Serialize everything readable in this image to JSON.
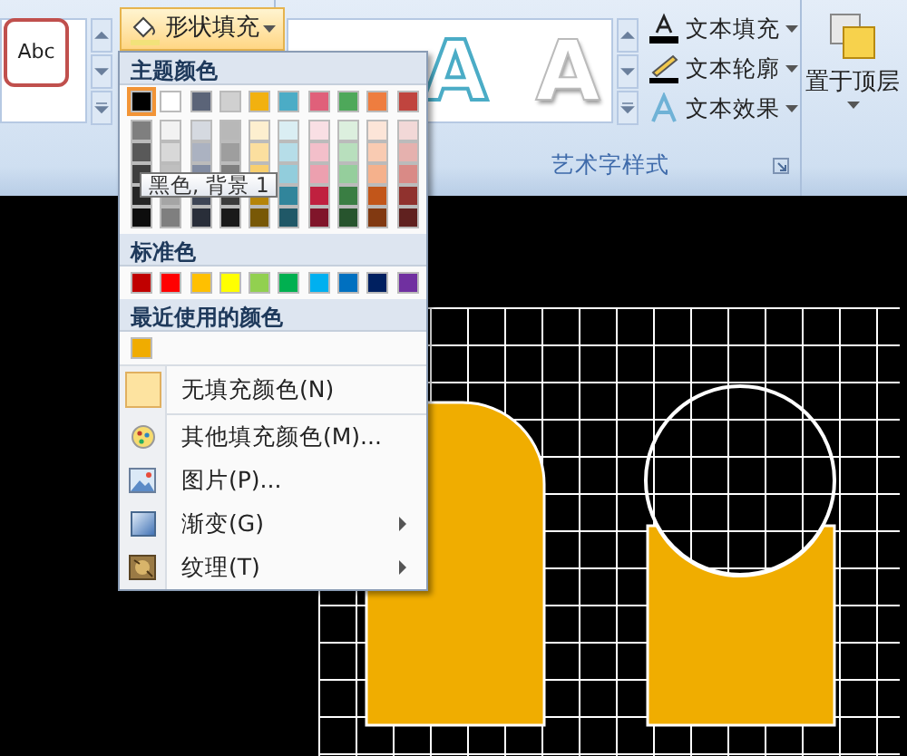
{
  "ribbon": {
    "style_sample": {
      "text": "Abc",
      "selected": true
    },
    "shape_fill_button": "形状填充",
    "wordart_samples": [
      {
        "text": "A",
        "kind": "outline"
      },
      {
        "text": "A",
        "kind": "emboss"
      }
    ],
    "text_buttons": [
      {
        "label": "文本填充",
        "kind": "fill"
      },
      {
        "label": "文本轮廓",
        "kind": "outline"
      },
      {
        "label": "文本效果",
        "kind": "effect"
      }
    ],
    "wordart_group_label": "艺术字样式",
    "arrange_button": "置于顶层"
  },
  "color_menu": {
    "theme_header": "主题颜色",
    "theme_colors": [
      {
        "color": "#000000",
        "selected": true,
        "shades": [
          {
            "color": "#7f7f7f"
          },
          {
            "color": "#595959"
          },
          {
            "color": "#3f3f3f"
          },
          {
            "color": "#262626"
          },
          {
            "color": "#0d0d0d"
          }
        ]
      },
      {
        "color": "#ffffff",
        "selected": false,
        "shades": [
          {
            "color": "#f2f2f2"
          },
          {
            "color": "#d8d8d8"
          },
          {
            "color": "#bfbfbf"
          },
          {
            "color": "#a5a5a5"
          },
          {
            "color": "#7f7f7f"
          }
        ]
      },
      {
        "color": "#5b6478",
        "selected": false,
        "shades": [
          {
            "color": "#d5d9e0"
          },
          {
            "color": "#abb2c1"
          },
          {
            "color": "#828ca2"
          },
          {
            "color": "#3e4555"
          },
          {
            "color": "#292e39"
          }
        ]
      },
      {
        "color": "#d0d0d0",
        "selected": false,
        "shades": [
          {
            "color": "#b8b8b8"
          },
          {
            "color": "#9e9e9e"
          },
          {
            "color": "#7f7f7f"
          },
          {
            "color": "#3b3b3b"
          },
          {
            "color": "#1a1a1a"
          }
        ]
      },
      {
        "color": "#f2b10f",
        "selected": false,
        "shades": [
          {
            "color": "#fdefcf"
          },
          {
            "color": "#fbdf9f"
          },
          {
            "color": "#f8cf6f"
          },
          {
            "color": "#b58409"
          },
          {
            "color": "#785806"
          }
        ]
      },
      {
        "color": "#4bacc6",
        "selected": false,
        "shades": [
          {
            "color": "#daeef3"
          },
          {
            "color": "#b6dde8"
          },
          {
            "color": "#92cddc"
          },
          {
            "color": "#31859b"
          },
          {
            "color": "#205867"
          }
        ]
      },
      {
        "color": "#e0607a",
        "selected": false,
        "shades": [
          {
            "color": "#f9dfe4"
          },
          {
            "color": "#f3bfca"
          },
          {
            "color": "#eca0af"
          },
          {
            "color": "#c0203f"
          },
          {
            "color": "#80152a"
          }
        ]
      },
      {
        "color": "#4ea85a",
        "selected": false,
        "shades": [
          {
            "color": "#dcefde"
          },
          {
            "color": "#b8dfbd"
          },
          {
            "color": "#95ce9c"
          },
          {
            "color": "#3a7e43"
          },
          {
            "color": "#27542d"
          }
        ]
      },
      {
        "color": "#ee7d3f",
        "selected": false,
        "shades": [
          {
            "color": "#fce5d8"
          },
          {
            "color": "#f9cbb2"
          },
          {
            "color": "#f5b18c"
          },
          {
            "color": "#c2561a"
          },
          {
            "color": "#813911"
          }
        ]
      },
      {
        "color": "#c0443e",
        "selected": false,
        "shades": [
          {
            "color": "#f2d8d7"
          },
          {
            "color": "#e5b1ae"
          },
          {
            "color": "#d98a86"
          },
          {
            "color": "#90322e"
          },
          {
            "color": "#60211f"
          }
        ]
      }
    ],
    "tooltip": "黑色, 背景 1",
    "standard_header": "标准色",
    "standard_colors": [
      {
        "color": "#c00000"
      },
      {
        "color": "#ff0000"
      },
      {
        "color": "#ffc000"
      },
      {
        "color": "#ffff00"
      },
      {
        "color": "#92d050"
      },
      {
        "color": "#00b050"
      },
      {
        "color": "#00b0f0"
      },
      {
        "color": "#0070c0"
      },
      {
        "color": "#002060"
      },
      {
        "color": "#7030a0"
      }
    ],
    "recent_header": "最近使用的颜色",
    "recent_colors": [
      {
        "color": "#f0ac00"
      }
    ],
    "items": [
      {
        "label": "无填充颜色(N)",
        "kind": "no-fill",
        "submenu": false
      },
      {
        "label": "其他填充颜色(M)...",
        "kind": "palette",
        "submenu": false
      },
      {
        "label": "图片(P)...",
        "kind": "picture",
        "submenu": false
      },
      {
        "label": "渐变(G)",
        "kind": "gradient",
        "submenu": true
      },
      {
        "label": "纹理(T)",
        "kind": "texture",
        "submenu": true
      }
    ]
  }
}
